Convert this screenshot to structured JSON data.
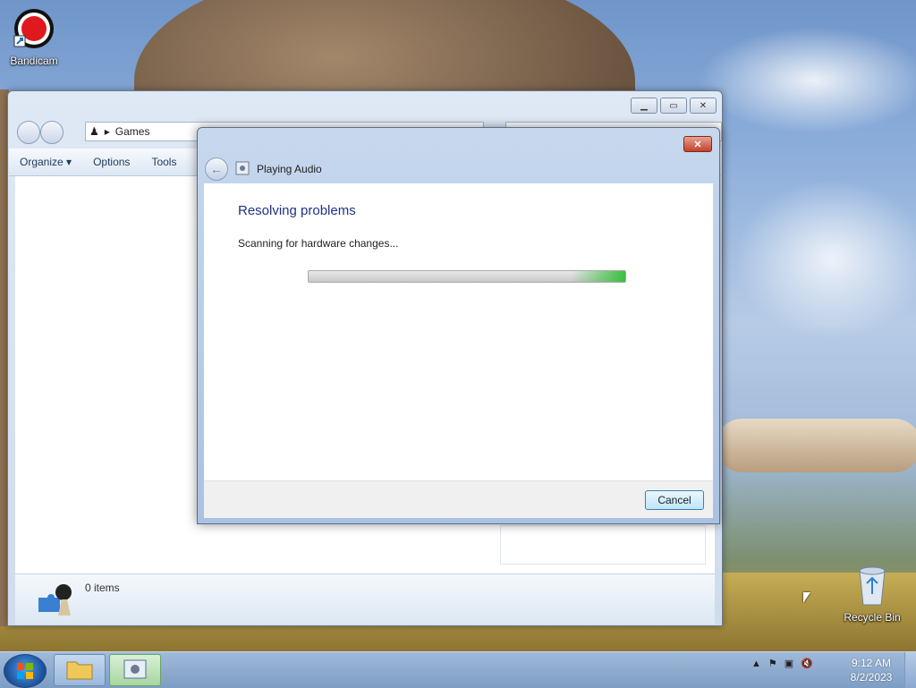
{
  "desktop": {
    "icons": [
      {
        "label": "Bandicam",
        "icon": "bandicam-icon"
      },
      {
        "label": "Recycle Bin",
        "icon": "recycle-bin-icon"
      }
    ]
  },
  "explorer": {
    "address": {
      "crumb_separator": "▸",
      "location": "Games"
    },
    "toolbar": {
      "organize": "Organize",
      "options": "Options",
      "tools": "Tools"
    },
    "status": {
      "items": "0 items"
    }
  },
  "dialog": {
    "title": "Playing Audio",
    "heading": "Resolving problems",
    "status": "Scanning for hardware changes...",
    "progress": 1.0,
    "cancel": "Cancel"
  },
  "taskbar": {
    "clock_time": "9:12 AM",
    "clock_date": "8/2/2023",
    "tray_icons": [
      "show-hidden-icons",
      "action-center-icon",
      "network-icon",
      "volume-muted-icon"
    ]
  },
  "colors": {
    "accent": "#1e3287",
    "progress_green": "#37c03f",
    "close_red": "#c4412b"
  }
}
